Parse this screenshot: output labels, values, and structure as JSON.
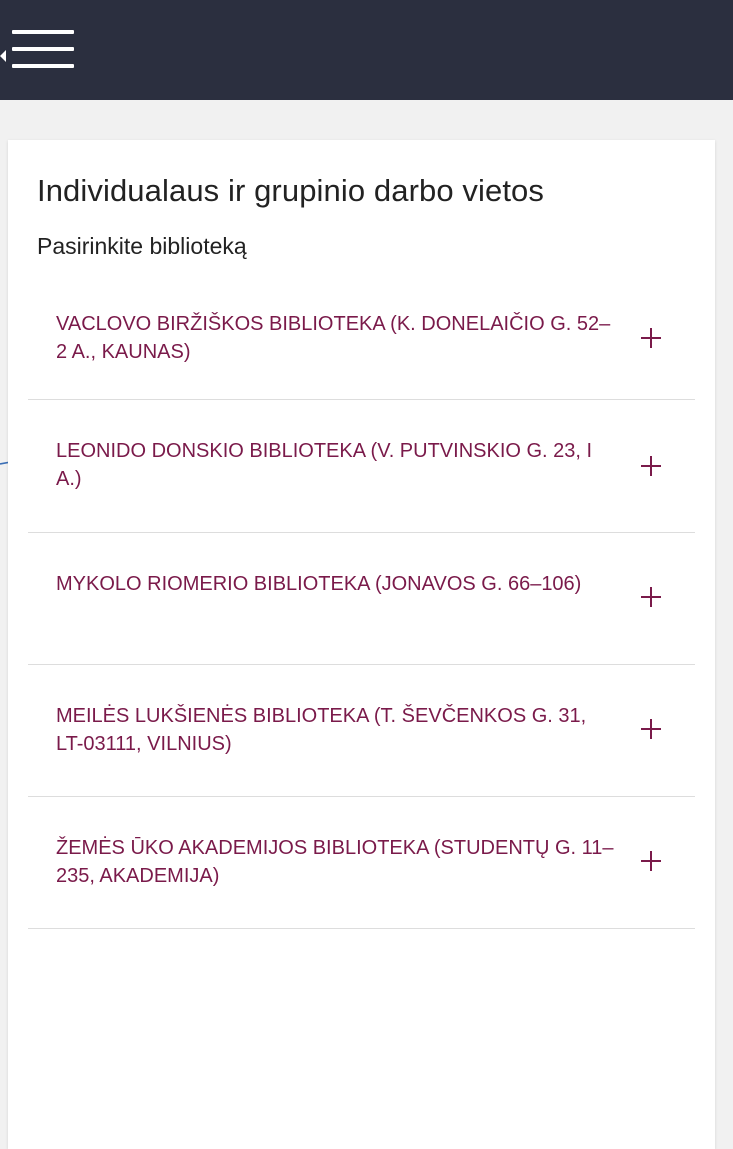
{
  "header": {
    "menu_icon": "hamburger-menu-icon"
  },
  "page": {
    "title": "Individualaus ir grupinio darbo vietos",
    "subtitle": "Pasirinkite biblioteką"
  },
  "libraries": [
    {
      "label": "VACLOVO BIRŽIŠKOS BIBLIOTEKA (K. DONELAIČIO G. 52–2 A., KAUNAS)",
      "icon": "plus-icon"
    },
    {
      "label": "LEONIDO DONSKIO BIBLIOTEKA (V. PUTVINSKIO G. 23, I A.)",
      "icon": "plus-icon"
    },
    {
      "label": "MYKOLO RIOMERIO BIBLIOTEKA (JONAVOS G. 66–106)",
      "icon": "plus-icon"
    },
    {
      "label": "MEILĖS LUKŠIENĖS BIBLIOTEKA (T. ŠEVČENKOS G. 31, LT-03111, VILNIUS)",
      "icon": "plus-icon"
    },
    {
      "label": "ŽEMĖS ŪKO AKADEMIJOS BIBLIOTEKA (STUDENTŲ G. 11–235, AKADEMIJA)",
      "icon": "plus-icon"
    }
  ],
  "colors": {
    "header_bg": "#2b2f3f",
    "page_bg": "#f1f1f1",
    "link": "#7a1a4a",
    "annotation_arrow": "#3b6fb6"
  }
}
